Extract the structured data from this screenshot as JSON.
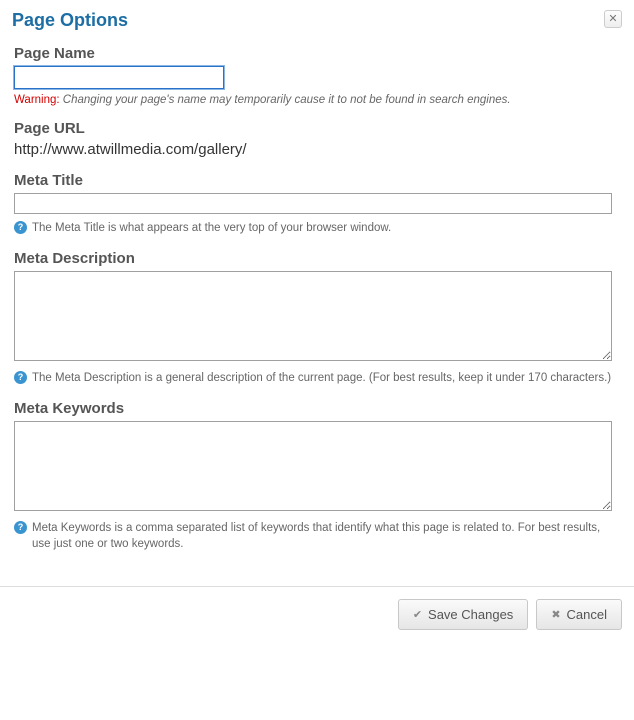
{
  "dialog": {
    "title": "Page Options"
  },
  "page_name": {
    "label": "Page Name",
    "value": "",
    "warning_label": "Warning:",
    "warning_text": "Changing your page's name may temporarily cause it to not be found in search engines."
  },
  "page_url": {
    "label": "Page URL",
    "value": "http://www.atwillmedia.com/gallery/"
  },
  "meta_title": {
    "label": "Meta Title",
    "value": "",
    "help": "The Meta Title is what appears at the very top of your browser window."
  },
  "meta_description": {
    "label": "Meta Description",
    "value": "",
    "help": "The Meta Description is a general description of the current page. (For best results, keep it under 170 characters.)"
  },
  "meta_keywords": {
    "label": "Meta Keywords",
    "value": "",
    "help": "Meta Keywords is a comma separated list of keywords that identify what this page is related to. For best results, use just one or two keywords."
  },
  "buttons": {
    "save": "Save Changes",
    "cancel": "Cancel"
  }
}
